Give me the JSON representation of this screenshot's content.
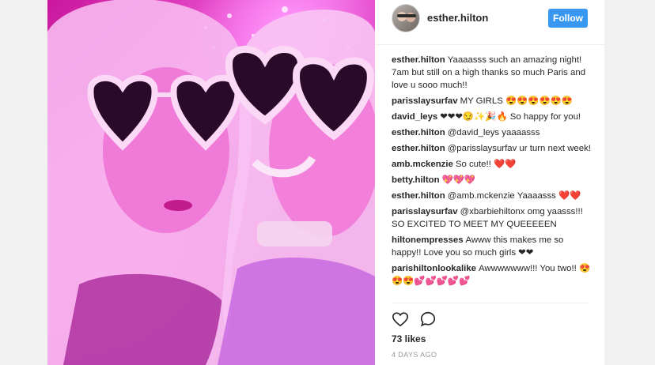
{
  "post": {
    "username": "esther.hilton",
    "follow_label": "Follow",
    "likes": "73 likes",
    "time": "4 DAYS AGO"
  },
  "comments": [
    {
      "user": "esther.hilton",
      "text": "Yaaaasss such an amazing night! 7am but still on a high thanks so much Paris and love u sooo much!!"
    },
    {
      "user": "parisslaysurfav",
      "text": "MY GIRLS 😍😍😍😍😍😍"
    },
    {
      "user": "david_leys",
      "text": "❤❤❤😏✨🎉🔥 So happy for you!"
    },
    {
      "user": "esther.hilton",
      "text": "@david_leys yaaaasss"
    },
    {
      "user": "esther.hilton",
      "text": "@parisslaysurfav ur turn next week!"
    },
    {
      "user": "amb.mckenzie",
      "text": "So cute!! ❤️❤️"
    },
    {
      "user": "betty.hilton",
      "text": "💖💖💖"
    },
    {
      "user": "esther.hilton",
      "text": "@amb.mckenzie Yaaaasss ❤️❤️"
    },
    {
      "user": "parisslaysurfav",
      "text": "@xbarbiehiltonx omg yaasss!!! SO EXCITED TO MEET MY QUEEEEEN"
    },
    {
      "user": "hiltonempresses",
      "text": "Awww this makes me so happy!! Love you so much girls ❤❤"
    },
    {
      "user": "parishiltonlookalike",
      "text": "Awwwwwww!!! You two!! 😍😍😍💕💕💕💕💕"
    }
  ],
  "colors": {
    "follow_button": "#3897f0",
    "photo_magenta": "#d42fb7"
  },
  "icons": [
    "heart-icon",
    "comment-icon"
  ]
}
